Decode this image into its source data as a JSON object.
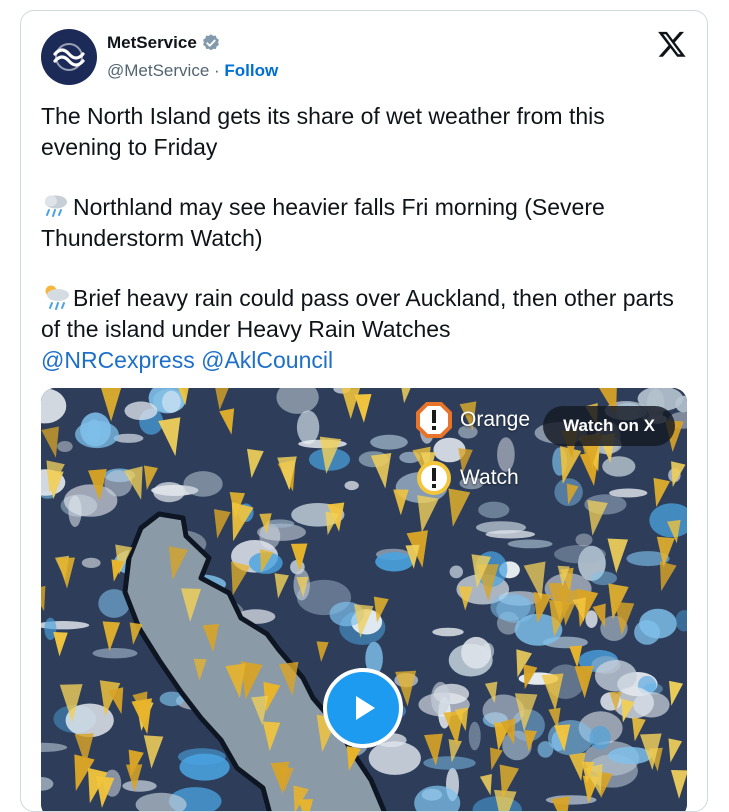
{
  "account": {
    "name": "MetService",
    "handle": "@MetService",
    "separator": " · ",
    "follow_label": "Follow"
  },
  "icons": {
    "avatar": "metservice-logo",
    "verified": "verified-badge-icon",
    "platform": "x-logo-icon",
    "emoji_1": "cloud-with-rain",
    "emoji_2": "sun-behind-rain-cloud",
    "play": "play-icon"
  },
  "post": {
    "paragraph_1": "The North Island gets its share of wet weather from this evening to Friday",
    "paragraph_2": "Northland may see heavier falls Fri morning (Severe Thunderstorm Watch)",
    "paragraph_3": "Brief heavy rain could pass over Auckland, then other parts of the island under Heavy Rain Watches",
    "mentions": [
      "@NRCexpress",
      "@AklCouncil"
    ]
  },
  "media": {
    "legend_orange": "Orange",
    "legend_watch": "Watch",
    "watch_on_x_label": "Watch on X"
  },
  "colors": {
    "link": "#1d6fc9",
    "follow": "#006fd6",
    "play_button": "#1d9bf0",
    "warning_orange": "#e8742a",
    "watch_yellow": "#f2c53d",
    "avatar_bg": "#1b2a57"
  }
}
